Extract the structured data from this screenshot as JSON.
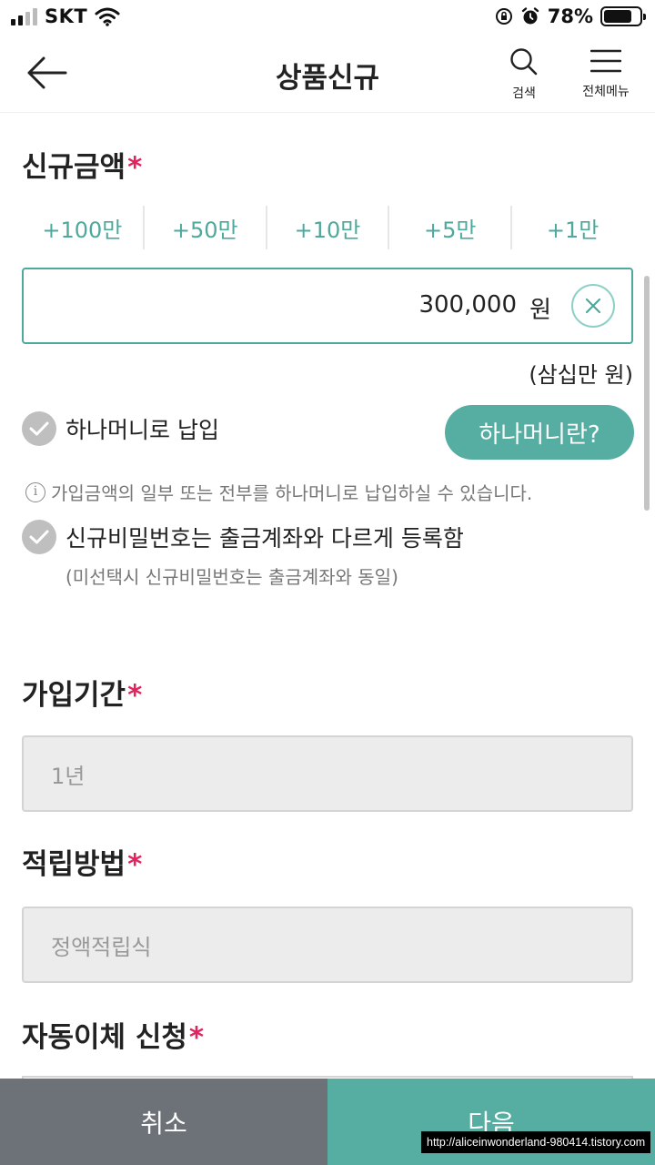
{
  "status_bar": {
    "carrier": "SKT",
    "battery_percent": "78%",
    "battery_level": 0.78,
    "icons": [
      "signal-icon",
      "wifi-icon",
      "rotation-lock-icon",
      "alarm-icon",
      "battery-icon"
    ]
  },
  "header": {
    "title": "상품신규",
    "search_label": "검색",
    "menu_label": "전체메뉴"
  },
  "amount_section": {
    "title": "신규금액",
    "required_mark": "*",
    "quick_buttons": [
      "+100만",
      "+50만",
      "+10만",
      "+5만",
      "+1만"
    ],
    "value": "300,000",
    "unit": "원",
    "korean_amount": "(삼십만 원)"
  },
  "hanamoney": {
    "checkbox_label": "하나머니로 납입",
    "info_button": "하나머니란?",
    "info_text": "가입금액의 일부 또는 전부를 하나머니로 납입하실 수 있습니다."
  },
  "password_option": {
    "checkbox_label": "신규비밀번호는 출금계좌와 다르게 등록함",
    "note": "(미선택시 신규비밀번호는 출금계좌와 동일)"
  },
  "period_section": {
    "title": "가입기간",
    "required_mark": "*",
    "value": "1년"
  },
  "method_section": {
    "title": "적립방법",
    "required_mark": "*",
    "value": "정액적립식"
  },
  "transfer_section": {
    "title": "자동이체 신청",
    "required_mark": "*"
  },
  "bottom_buttons": {
    "cancel": "취소",
    "next": "다음"
  },
  "watermark": "http://aliceinwonderland-980414.tistory.com",
  "colors": {
    "accent": "#56ada1",
    "required": "#e0245e",
    "cancel": "#6c7278"
  }
}
